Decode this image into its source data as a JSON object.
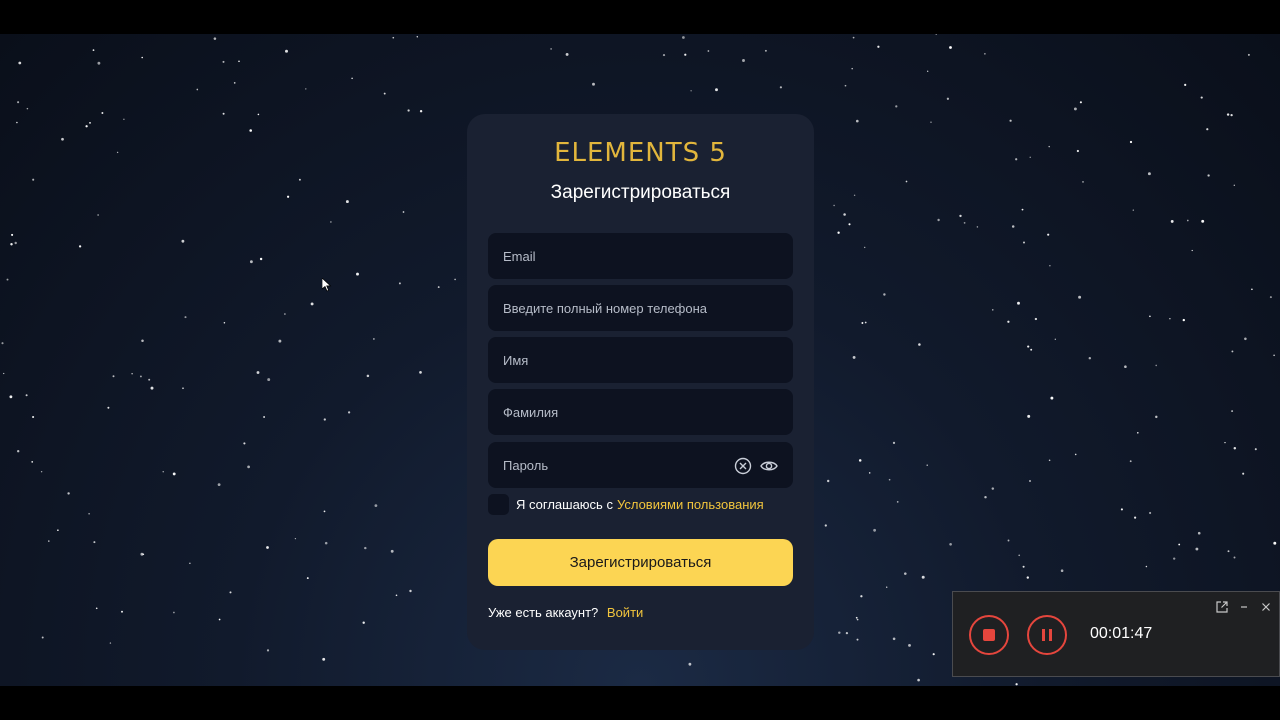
{
  "brand": {
    "logo_text": "ELEMENTS 5",
    "logo_color": "#e2b63c"
  },
  "form": {
    "title": "Зарегистрироваться",
    "fields": {
      "email_placeholder": "Email",
      "phone_placeholder": "Введите полный номер телефона",
      "first_name_placeholder": "Имя",
      "last_name_placeholder": "Фамилия",
      "password_placeholder": "Пароль"
    },
    "password_icons": [
      "clear-icon",
      "eye-icon"
    ],
    "agreement_text": "Я соглашаюсь с",
    "agreement_link": "Условиями пользования",
    "submit_label": "Зарегистрироваться",
    "login_prompt": "Уже есть аккаунт?",
    "login_link": "Войти"
  },
  "recorder": {
    "time": "00:01:47",
    "icons": [
      "popout-icon",
      "minimize-icon",
      "close-icon",
      "stop-icon",
      "pause-icon"
    ]
  },
  "colors": {
    "accent": "#fcd553",
    "link": "#f2c53d",
    "card_bg": "#1a2132",
    "field_bg": "#0d1220",
    "record_red": "#e5463d"
  }
}
